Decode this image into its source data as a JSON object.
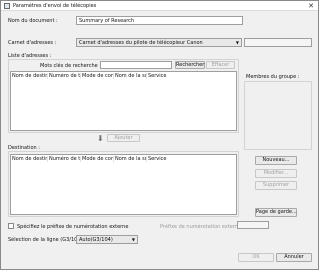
{
  "window": {
    "title": "Paramètres d'envoi de télécopies"
  },
  "document_name": {
    "label": "Nom du document :",
    "value": "Summary of Research"
  },
  "address_book": {
    "label": "Carnet d'adresses :",
    "selected": "Carnet d'adresses du pilote de télécopieur Canon"
  },
  "address_list": {
    "label": "Liste d'adresses :",
    "search_label": "Mots clés de recherche :",
    "search_button": "Rechercher",
    "clear_button": "Effacer",
    "columns": [
      "Nom de destination",
      "Numéro de téléco...",
      "Mode de commu...",
      "Nom de la société",
      "Service"
    ]
  },
  "group_members": {
    "label": "Membres du groupe :"
  },
  "add_button": "Ajouter",
  "destination": {
    "label": "Destination :",
    "columns": [
      "Nom de destination",
      "Numéro de téléco...",
      "Mode de commu...",
      "Nom de la société",
      "Service"
    ],
    "buttons": {
      "new": "Nouveau...",
      "modify": "Modifier...",
      "delete": "Supprimer"
    }
  },
  "cover_page_button": "Page de garde...",
  "prefix": {
    "checkbox_label": "Spécifiez le préfixe de numérotation externe",
    "prefix_label": "Préfixe de numérotation externe :"
  },
  "line_selection": {
    "label": "Sélection de la ligne (G3/104) :",
    "selected": "Auto(G3/104)"
  },
  "footer": {
    "ok": "OK",
    "cancel": "Annuler"
  },
  "icons": {
    "app": "fax-icon",
    "close": "close-icon",
    "down": "down-arrow-icon"
  }
}
